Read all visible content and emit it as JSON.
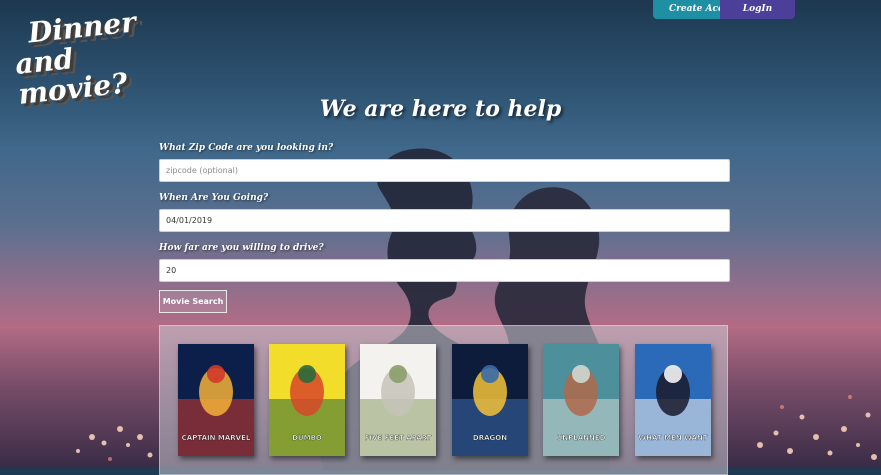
{
  "logo": {
    "line1": "Dinner",
    "line2": "and movie?"
  },
  "header": {
    "create_account_label": "Create Account",
    "login_label": "LogIn"
  },
  "main": {
    "heading": "We are here to help"
  },
  "form": {
    "zip_label": "What Zip Code are you looking in?",
    "zip_placeholder": "zipcode (optional)",
    "zip_value": "",
    "date_label": "When Are You Going?",
    "date_value": "04/01/2019",
    "distance_label": "How far are you willing to drive?",
    "distance_value": "20",
    "search_button_label": "Movie Search"
  },
  "results": {
    "posters": [
      {
        "title": "Captain Marvel",
        "caption": "CAPTAIN MARVEL",
        "colors": [
          "#0c1e4a",
          "#d13a2a",
          "#f4b23a"
        ]
      },
      {
        "title": "Dumbo",
        "caption": "DUMBO",
        "colors": [
          "#f2de2a",
          "#2a6a3a",
          "#d8472a"
        ]
      },
      {
        "title": "Five Feet Apart",
        "caption": "FIVE FEET APART",
        "colors": [
          "#f4f2ee",
          "#8b9f6a",
          "#c5c4b8"
        ]
      },
      {
        "title": "How to Train Your Dragon: The Hidden World",
        "caption": "DRAGON",
        "colors": [
          "#0c1c3a",
          "#3a6aa8",
          "#f4c23a"
        ]
      },
      {
        "title": "Unplanned",
        "caption": "UNPLANNED",
        "colors": [
          "#4d8f9a",
          "#cfd8d4",
          "#b06a4a"
        ]
      },
      {
        "title": "What Men Want",
        "caption": "WHAT MEN WANT",
        "colors": [
          "#2a6ab8",
          "#f4f4f4",
          "#1a1a2a"
        ]
      }
    ]
  }
}
